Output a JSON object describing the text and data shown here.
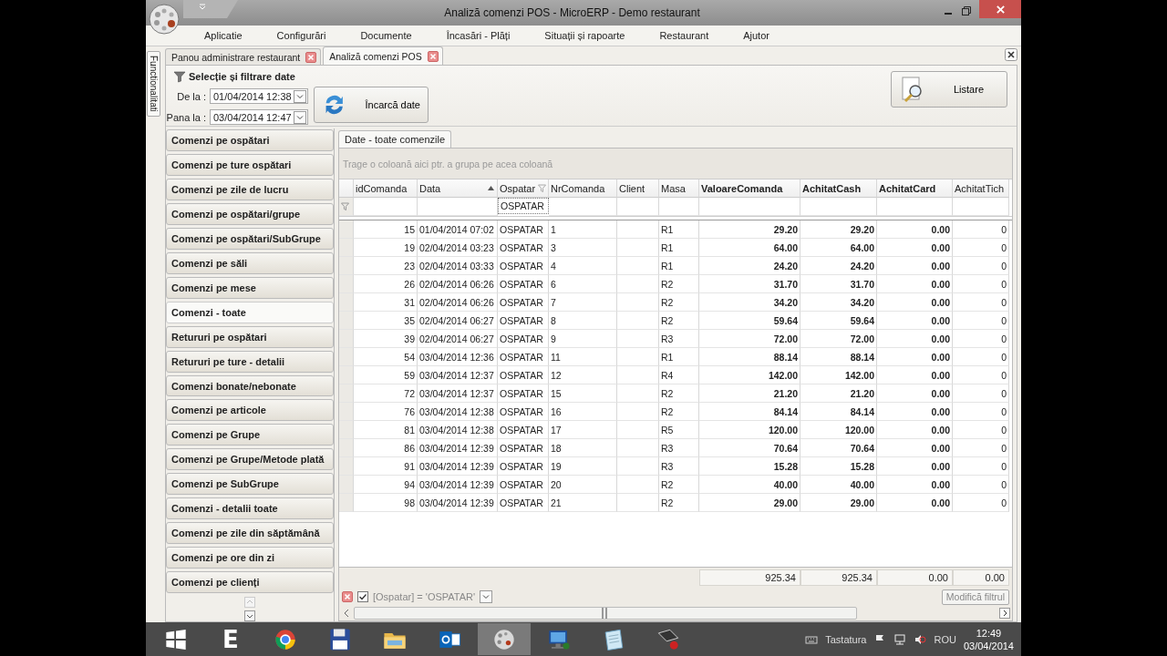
{
  "window": {
    "title": "Analiză comenzi POS - MicroERP - Demo restaurant"
  },
  "menu": [
    "Aplicatie",
    "Configurări",
    "Documente",
    "Încasări - Plăți",
    "Situații și rapoarte",
    "Restaurant",
    "Ajutor"
  ],
  "doc_tabs": [
    {
      "label": "Panou administrare restaurant",
      "selected": false
    },
    {
      "label": "Analiză comenzi POS",
      "selected": true
    }
  ],
  "side_tab": "Functionalitati",
  "filter_panel": {
    "title": "Selecție și filtrare date",
    "from_label": "De la :",
    "from_value": "01/04/2014 12:38",
    "to_label": "Pana la :",
    "to_value": "03/04/2014 12:47",
    "load_button": "Încarcă date",
    "list_button": "Listare"
  },
  "reports": [
    {
      "label": "Comenzi pe ospătari",
      "selected": false
    },
    {
      "label": "Comenzi pe ture ospătari",
      "selected": false
    },
    {
      "label": "Comenzi pe zile de lucru",
      "selected": false
    },
    {
      "label": "Comenzi pe ospătari/grupe",
      "selected": false
    },
    {
      "label": "Comenzi pe ospătari/SubGrupe",
      "selected": false
    },
    {
      "label": "Comenzi pe săli",
      "selected": false
    },
    {
      "label": "Comenzi pe mese",
      "selected": false
    },
    {
      "label": "Comenzi - toate",
      "selected": true
    },
    {
      "label": "Retururi pe ospătari",
      "selected": false
    },
    {
      "label": "Retururi pe ture - detalii",
      "selected": false
    },
    {
      "label": "Comenzi bonate/nebonate",
      "selected": false
    },
    {
      "label": "Comenzi pe articole",
      "selected": false
    },
    {
      "label": "Comenzi pe Grupe",
      "selected": false
    },
    {
      "label": "Comenzi pe Grupe/Metode plată",
      "selected": false
    },
    {
      "label": "Comenzi pe SubGrupe",
      "selected": false
    },
    {
      "label": "Comenzi - detalii toate",
      "selected": false
    },
    {
      "label": "Comenzi pe zile din săptămână",
      "selected": false
    },
    {
      "label": "Comenzi pe ore din zi",
      "selected": false
    },
    {
      "label": "Comenzi pe clienți",
      "selected": false
    }
  ],
  "grid_tab": "Date - toate comenzile",
  "group_hint": "Trage o coloană aici ptr. a grupa pe acea coloană",
  "columns": [
    {
      "label": "idComanda",
      "kind": "number",
      "sorted": false
    },
    {
      "label": "Data",
      "kind": "text",
      "sorted": true
    },
    {
      "label": "Ospatar",
      "kind": "text",
      "sorted": false,
      "filter_text": "OSPATAR"
    },
    {
      "label": "NrComanda",
      "kind": "text",
      "sorted": false
    },
    {
      "label": "Client",
      "kind": "text",
      "sorted": false
    },
    {
      "label": "Masa",
      "kind": "text",
      "sorted": false
    },
    {
      "label": "ValoareComanda",
      "kind": "amount",
      "sorted": false,
      "total": "925.34"
    },
    {
      "label": "AchitatCash",
      "kind": "amount",
      "sorted": false,
      "total": "925.34"
    },
    {
      "label": "AchitatCard",
      "kind": "amount",
      "sorted": false,
      "total": "0.00"
    },
    {
      "label": "AchitatTich",
      "kind": "number",
      "sorted": false,
      "total": "0.00"
    }
  ],
  "rows": [
    [
      "15",
      "01/04/2014 07:02",
      "OSPATAR",
      "1",
      null,
      "R1",
      "29.20",
      "29.20",
      "0.00",
      "0"
    ],
    [
      "19",
      "02/04/2014 03:23",
      "OSPATAR",
      "3",
      null,
      "R1",
      "64.00",
      "64.00",
      "0.00",
      "0"
    ],
    [
      "23",
      "02/04/2014 03:33",
      "OSPATAR",
      "4",
      null,
      "R1",
      "24.20",
      "24.20",
      "0.00",
      "0"
    ],
    [
      "26",
      "02/04/2014 06:26",
      "OSPATAR",
      "6",
      null,
      "R2",
      "31.70",
      "31.70",
      "0.00",
      "0"
    ],
    [
      "31",
      "02/04/2014 06:26",
      "OSPATAR",
      "7",
      null,
      "R2",
      "34.20",
      "34.20",
      "0.00",
      "0"
    ],
    [
      "35",
      "02/04/2014 06:27",
      "OSPATAR",
      "8",
      null,
      "R2",
      "59.64",
      "59.64",
      "0.00",
      "0"
    ],
    [
      "39",
      "02/04/2014 06:27",
      "OSPATAR",
      "9",
      null,
      "R3",
      "72.00",
      "72.00",
      "0.00",
      "0"
    ],
    [
      "54",
      "03/04/2014 12:36",
      "OSPATAR",
      "11",
      null,
      "R1",
      "88.14",
      "88.14",
      "0.00",
      "0"
    ],
    [
      "59",
      "03/04/2014 12:37",
      "OSPATAR",
      "12",
      null,
      "R4",
      "142.00",
      "142.00",
      "0.00",
      "0"
    ],
    [
      "72",
      "03/04/2014 12:37",
      "OSPATAR",
      "15",
      null,
      "R2",
      "21.20",
      "21.20",
      "0.00",
      "0"
    ],
    [
      "76",
      "03/04/2014 12:38",
      "OSPATAR",
      "16",
      null,
      "R2",
      "84.14",
      "84.14",
      "0.00",
      "0"
    ],
    [
      "81",
      "03/04/2014 12:38",
      "OSPATAR",
      "17",
      null,
      "R5",
      "120.00",
      "120.00",
      "0.00",
      "0"
    ],
    [
      "86",
      "03/04/2014 12:39",
      "OSPATAR",
      "18",
      null,
      "R3",
      "70.64",
      "70.64",
      "0.00",
      "0"
    ],
    [
      "91",
      "03/04/2014 12:39",
      "OSPATAR",
      "19",
      null,
      "R3",
      "15.28",
      "15.28",
      "0.00",
      "0"
    ],
    [
      "94",
      "03/04/2014 12:39",
      "OSPATAR",
      "20",
      null,
      "R2",
      "40.00",
      "40.00",
      "0.00",
      "0"
    ],
    [
      "98",
      "03/04/2014 12:39",
      "OSPATAR",
      "21",
      null,
      "R2",
      "29.00",
      "29.00",
      "0.00",
      "0"
    ]
  ],
  "filter_bar": {
    "enabled": true,
    "expression": "[Ospatar] = 'OSPATAR'",
    "edit_button": "Modifică filtrul"
  },
  "taskbar": {
    "apps": [
      {
        "kind": "windows",
        "selected": false
      },
      {
        "kind": "letter",
        "label": "E",
        "selected": false
      },
      {
        "kind": "browser",
        "selected": false
      },
      {
        "kind": "floppy",
        "selected": false
      },
      {
        "kind": "folder",
        "selected": false
      },
      {
        "kind": "mail",
        "selected": false
      },
      {
        "kind": "dots",
        "selected": true
      },
      {
        "kind": "computer",
        "selected": false
      },
      {
        "kind": "notepad",
        "selected": false
      },
      {
        "kind": "terminal",
        "selected": false
      }
    ],
    "keyboard": "Tastatura",
    "language": "ROU",
    "time": "12:49",
    "date": "03/04/2014"
  }
}
